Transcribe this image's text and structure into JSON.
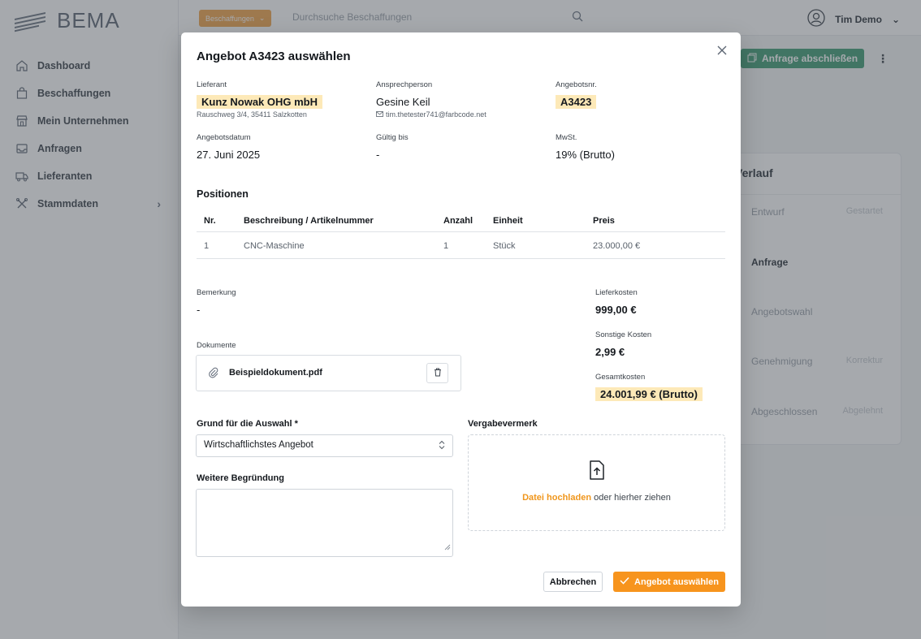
{
  "app": {
    "logo_text": "BEMA",
    "breadcrumb_pill": "Beschaffungen",
    "search_placeholder": "Durchsuche Beschaffungen",
    "user_name": "Tim Demo"
  },
  "sidebar": {
    "items": [
      {
        "label": "Dashboard",
        "icon": "home-icon"
      },
      {
        "label": "Beschaffungen",
        "icon": "shopping-bag-icon"
      },
      {
        "label": "Mein Unternehmen",
        "icon": "store-icon"
      },
      {
        "label": "Anfragen",
        "icon": "inbox-icon"
      },
      {
        "label": "Lieferanten",
        "icon": "truck-icon"
      },
      {
        "label": "Stammdaten",
        "icon": "tools-icon"
      }
    ]
  },
  "background": {
    "action_button": "Anfrage abschließen",
    "card_title": "Verlauf",
    "steps": [
      {
        "label": "Entwurf",
        "right": "Gestartet"
      },
      {
        "label": "Anfrage",
        "right": ""
      },
      {
        "label": "Angebotswahl",
        "right": ""
      },
      {
        "label": "Genehmigung",
        "right": "Korrektur"
      },
      {
        "label": "Abgeschlossen",
        "right": "Abgelehnt"
      }
    ]
  },
  "modal": {
    "title": "Angebot A3423 auswählen",
    "supplier": {
      "label": "Lieferant",
      "name": "Kunz Nowak OHG mbH",
      "address": "Rauschweg 3/4, 35411 Salzkotten"
    },
    "contact": {
      "label": "Ansprechperson",
      "name": "Gesine Keil",
      "email": "tim.thetester741@farbcode.net"
    },
    "offer_no": {
      "label": "Angebotsnr.",
      "value": "A3423"
    },
    "offer_date": {
      "label": "Angebotsdatum",
      "value": "27. Juni 2025"
    },
    "valid_until": {
      "label": "Gültig bis",
      "value": "-"
    },
    "vat": {
      "label": "MwSt.",
      "value": "19% (Brutto)"
    },
    "positions": {
      "title": "Positionen",
      "headers": [
        "Nr.",
        "Beschreibung / Artikelnummer",
        "Anzahl",
        "Einheit",
        "Preis"
      ],
      "rows": [
        [
          "1",
          "CNC-Maschine",
          "1",
          "Stück",
          "23.000,00 €"
        ]
      ]
    },
    "remark": {
      "label": "Bemerkung",
      "value": "-"
    },
    "delivery_costs": {
      "label": "Lieferkosten",
      "value": "999,00 €"
    },
    "other_costs": {
      "label": "Sonstige Kosten",
      "value": "2,99 €"
    },
    "total_costs": {
      "label": "Gesamtkosten",
      "value": "24.001,99 € (Brutto)"
    },
    "documents": {
      "label": "Dokumente",
      "file": "Beispieldokument.pdf"
    },
    "reason": {
      "label": "Grund für die Auswahl *",
      "selected": "Wirtschaftlichstes Angebot"
    },
    "further": {
      "label": "Weitere Begründung",
      "value": ""
    },
    "award_note": {
      "label": "Vergabevermerk",
      "upload_link": "Datei hochladen",
      "upload_rest": "oder hierher ziehen"
    },
    "buttons": {
      "cancel": "Abbrechen",
      "confirm": "Angebot auswählen"
    }
  },
  "colors": {
    "accent_orange": "#f7941d",
    "highlight": "#fde9b8",
    "green": "#3e9b73"
  }
}
